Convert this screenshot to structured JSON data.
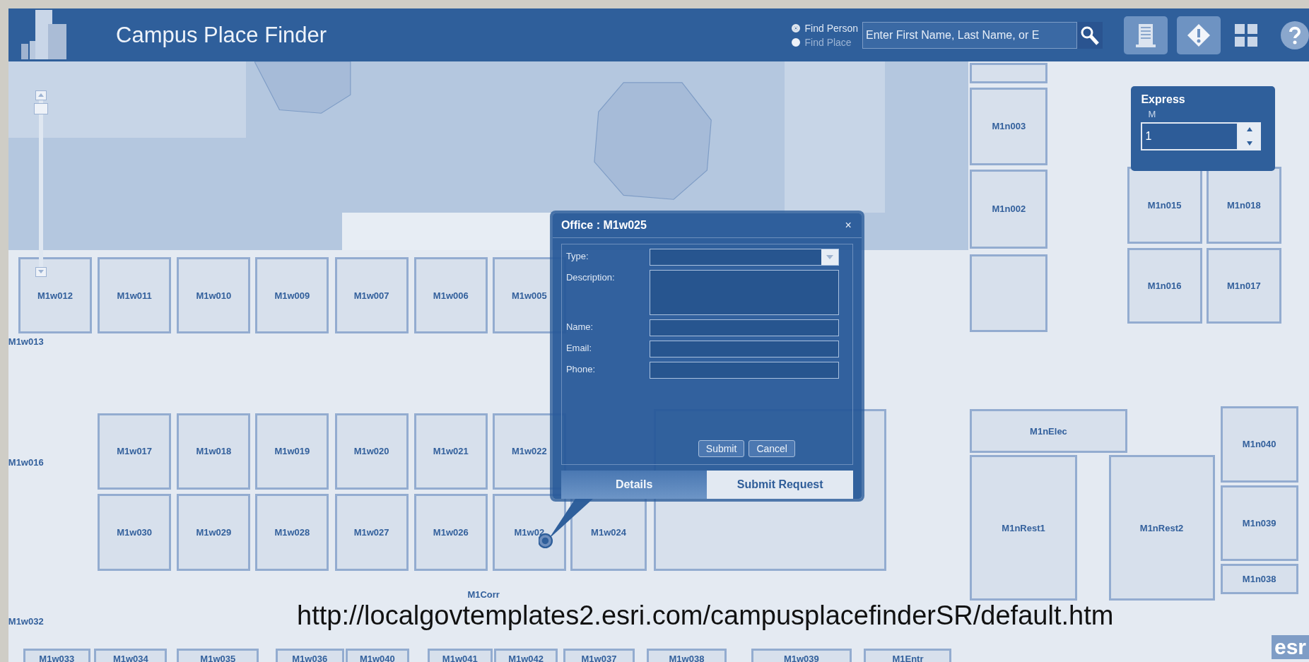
{
  "header": {
    "title": "Campus Place Finder",
    "search_modes": [
      {
        "label": "Find Person",
        "selected": true
      },
      {
        "label": "Find Place",
        "selected": false
      }
    ],
    "search": {
      "placeholder": "Enter First Name, Last Name, or E"
    }
  },
  "express": {
    "title": "Express",
    "label": "M",
    "value": "1"
  },
  "rooms": [
    {
      "label": "M1w012"
    },
    {
      "label": "M1w011"
    },
    {
      "label": "M1w010"
    },
    {
      "label": "M1w009"
    },
    {
      "label": "M1w007"
    },
    {
      "label": "M1w006"
    },
    {
      "label": "M1w005"
    },
    {
      "label": "M1w013"
    },
    {
      "label": "M1n003"
    },
    {
      "label": "M1n002"
    },
    {
      "label": "M1n015"
    },
    {
      "label": "M1n018"
    },
    {
      "label": "M1n016"
    },
    {
      "label": "M1n017"
    },
    {
      "label": "M1w016"
    },
    {
      "label": "M1w017"
    },
    {
      "label": "M1w018"
    },
    {
      "label": "M1w019"
    },
    {
      "label": "M1w020"
    },
    {
      "label": "M1w021"
    },
    {
      "label": "M1w022"
    },
    {
      "label": "M1w030"
    },
    {
      "label": "M1w029"
    },
    {
      "label": "M1w028"
    },
    {
      "label": "M1w027"
    },
    {
      "label": "M1w026"
    },
    {
      "label": "M1w02"
    },
    {
      "label": "M1w024"
    },
    {
      "label": "M1w032"
    },
    {
      "label": "M1Corr"
    },
    {
      "label": "M1nElec"
    },
    {
      "label": "M1nRest1"
    },
    {
      "label": "M1nRest2"
    },
    {
      "label": "M1n040"
    },
    {
      "label": "M1n039"
    },
    {
      "label": "M1n038"
    },
    {
      "label": "M1w033"
    },
    {
      "label": "M1w034"
    },
    {
      "label": "M1w035"
    },
    {
      "label": "M1w036"
    },
    {
      "label": "M1w040"
    },
    {
      "label": "M1w041"
    },
    {
      "label": "M1w042"
    },
    {
      "label": "M1w037"
    },
    {
      "label": "M1w038"
    },
    {
      "label": "M1w039"
    },
    {
      "label": "M1Entr"
    }
  ],
  "popup": {
    "title": "Office : M1w025",
    "close": "×",
    "fields": [
      {
        "label": "Type:",
        "kind": "dropdown"
      },
      {
        "label": "Description:",
        "kind": "textarea"
      },
      {
        "label": "Name:",
        "kind": "text"
      },
      {
        "label": "Email:",
        "kind": "text"
      },
      {
        "label": "Phone:",
        "kind": "text"
      }
    ],
    "buttons": [
      "Submit",
      "Cancel"
    ],
    "tabs": [
      {
        "label": "Details",
        "selected": true
      },
      {
        "label": "Submit Request",
        "selected": false
      }
    ]
  },
  "logo": "esr",
  "caption": "http://localgovtemplates2.esri.com/campusplacefinderSR/default.htm"
}
